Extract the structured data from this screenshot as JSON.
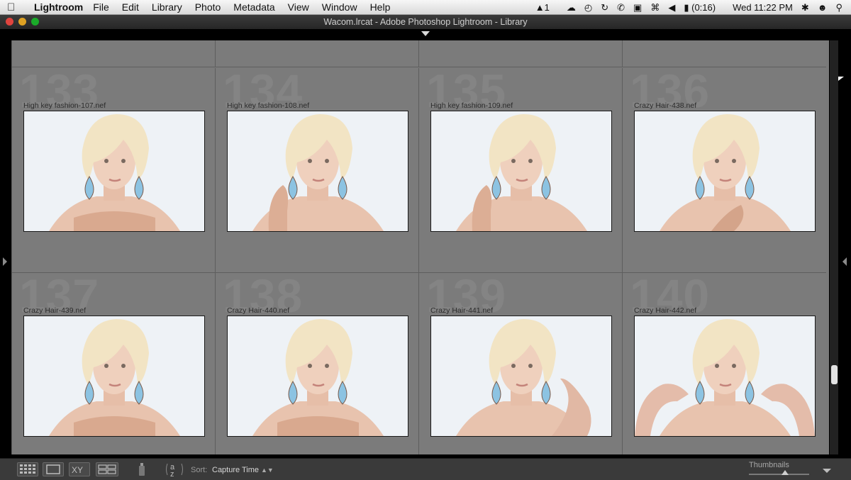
{
  "menubar": {
    "app": "Lightroom",
    "items": [
      "File",
      "Edit",
      "Library",
      "Photo",
      "Metadata",
      "View",
      "Window",
      "Help"
    ],
    "tray_adobe": "1",
    "battery": "(0:16)",
    "clock": "Wed 11:22 PM"
  },
  "window": {
    "title": "Wacom.lrcat - Adobe Photoshop Lightroom - Library"
  },
  "grid": {
    "rows": [
      [
        {
          "index": "133",
          "filename": "High key fashion-107.nef",
          "pose": "crossed"
        },
        {
          "index": "134",
          "filename": "High key fashion-108.nef",
          "pose": "hand-left"
        },
        {
          "index": "135",
          "filename": "High key fashion-109.nef",
          "pose": "hand-left"
        },
        {
          "index": "136",
          "filename": "Crazy Hair-438.nef",
          "pose": "hand-right"
        }
      ],
      [
        {
          "index": "137",
          "filename": "Crazy Hair-439.nef",
          "pose": "crossed"
        },
        {
          "index": "138",
          "filename": "Crazy Hair-440.nef",
          "pose": "crossed"
        },
        {
          "index": "139",
          "filename": "Crazy Hair-441.nef",
          "pose": "hand-up"
        },
        {
          "index": "140",
          "filename": "Crazy Hair-442.nef",
          "pose": "hands-up"
        }
      ]
    ]
  },
  "toolbar": {
    "sort_label": "Sort:",
    "sort_value": "Capture Time",
    "thumbnails_label": "Thumbnails",
    "thumbnail_size": 0.6
  },
  "colors": {
    "background": "#7b7b7b",
    "toolbar": "#3a3a3a",
    "accent_earring": "#7fb6d8"
  }
}
